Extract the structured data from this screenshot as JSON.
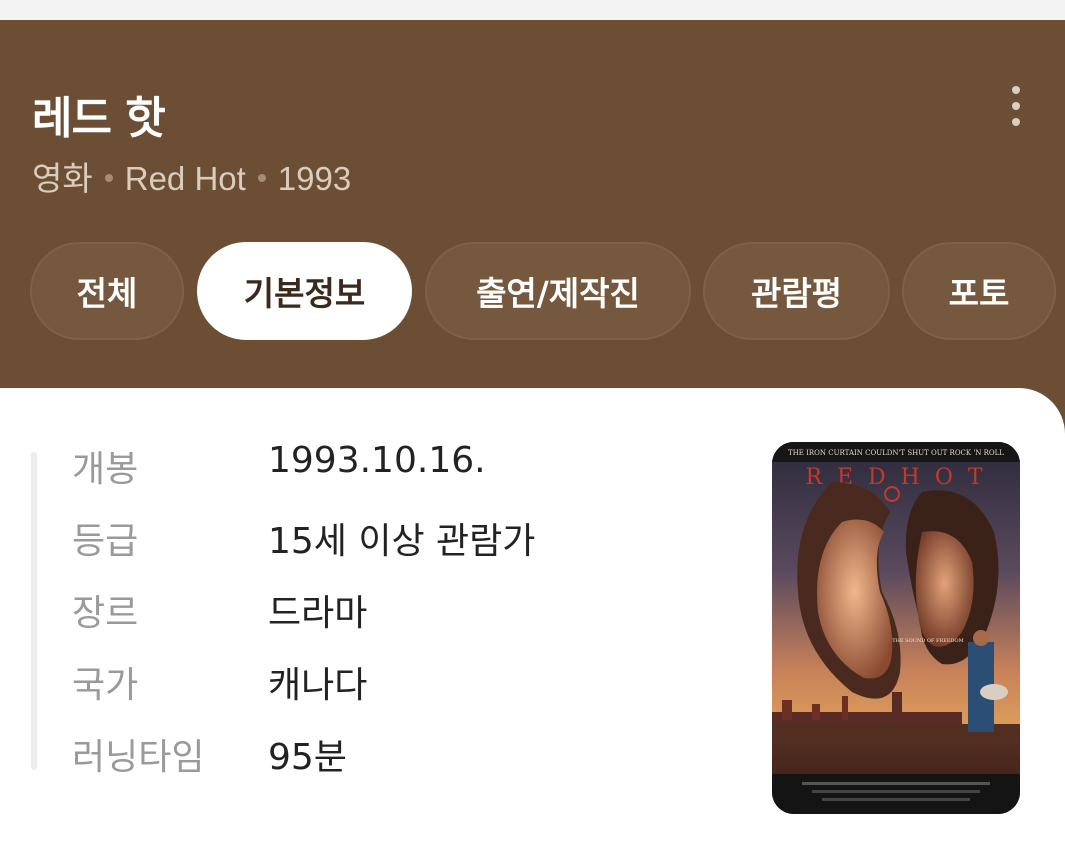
{
  "header": {
    "title": "레드 핫",
    "subtitle_parts": [
      "영화",
      "Red Hot",
      "1993"
    ]
  },
  "tabs": [
    {
      "label": "전체",
      "active": false
    },
    {
      "label": "기본정보",
      "active": true
    },
    {
      "label": "출연/제작진",
      "active": false
    },
    {
      "label": "관람평",
      "active": false
    },
    {
      "label": "포토",
      "active": false
    }
  ],
  "info": [
    {
      "label": "개봉",
      "value": "1993.10.16."
    },
    {
      "label": "등급",
      "value": "15세 이상 관람가"
    },
    {
      "label": "장르",
      "value": "드라마"
    },
    {
      "label": "국가",
      "value": "캐나다"
    },
    {
      "label": "러닝타임",
      "value": "95분"
    }
  ],
  "poster": {
    "tagline": "THE IRON CURTAIN COULDN'T SHUT OUT ROCK 'N ROLL",
    "title_letters": "R E D   H O T",
    "center_text": "THE SOUND OF FREEDOM"
  },
  "colors": {
    "header_bg": "#6b4e34",
    "tab_bg": "#75583d",
    "active_tab_bg": "#ffffff"
  },
  "icons": {
    "more": "more-vertical-icon"
  }
}
